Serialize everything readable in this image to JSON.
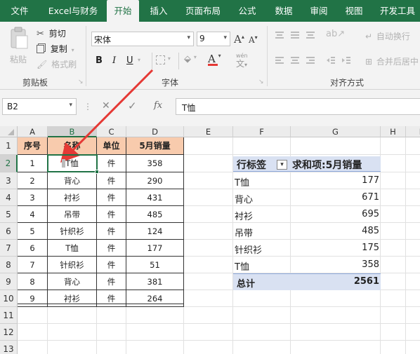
{
  "tabs": [
    "文件",
    "Excel与财务",
    "开始",
    "插入",
    "页面布局",
    "公式",
    "数据",
    "审阅",
    "视图",
    "开发工具"
  ],
  "clipboard": {
    "paste": "粘贴",
    "cut": "剪切",
    "copy": "复制",
    "format_painter": "格式刷",
    "group_label": "剪贴板"
  },
  "font": {
    "name": "宋体",
    "size": "9",
    "bold": "B",
    "italic": "I",
    "underline": "U",
    "font_color_glyph": "A",
    "phonetic_glyph": "wén",
    "group_label": "字体"
  },
  "alignment": {
    "wrap_text": "自动换行",
    "merge_center": "合并后居中",
    "group_label": "对齐方式"
  },
  "formula_bar": {
    "name_box": "B2",
    "fx": "fx",
    "content": "T恤"
  },
  "columns": [
    "A",
    "B",
    "C",
    "D",
    "E",
    "F",
    "G",
    "H",
    "I"
  ],
  "rows": [
    "1",
    "2",
    "3",
    "4",
    "5",
    "6",
    "7",
    "8",
    "9",
    "10",
    "11",
    "12",
    "13"
  ],
  "table": {
    "headers": [
      "序号",
      "名称",
      "单位",
      "5月销量"
    ],
    "rows": [
      [
        "1",
        "T恤",
        "件",
        "358"
      ],
      [
        "2",
        "背心",
        "件",
        "290"
      ],
      [
        "3",
        "衬衫",
        "件",
        "431"
      ],
      [
        "4",
        "吊带",
        "件",
        "485"
      ],
      [
        "5",
        "针织衫",
        "件",
        "124"
      ],
      [
        "6",
        "T恤",
        "件",
        "177"
      ],
      [
        "7",
        "针织衫",
        "件",
        "51"
      ],
      [
        "8",
        "背心",
        "件",
        "381"
      ],
      [
        "9",
        "衬衫",
        "件",
        "264"
      ]
    ]
  },
  "pivot": {
    "row_label_header": "行标签",
    "value_header": "求和项:5月销量",
    "rows": [
      {
        "label": "T恤",
        "value": "177"
      },
      {
        "label": "背心",
        "value": "671"
      },
      {
        "label": "衬衫",
        "value": "695"
      },
      {
        "label": "吊带",
        "value": "485"
      },
      {
        "label": "针织衫",
        "value": "175"
      },
      {
        "label": "T恤",
        "value": "358"
      }
    ],
    "total_label": "总计",
    "total_value": "2561"
  },
  "colors": {
    "ribbon_green": "#217346",
    "header_fill": "#f8cbad",
    "pivot_header_fill": "#d9e1f2",
    "arrow": "#e53935",
    "font_color_bar": "#e53935"
  }
}
